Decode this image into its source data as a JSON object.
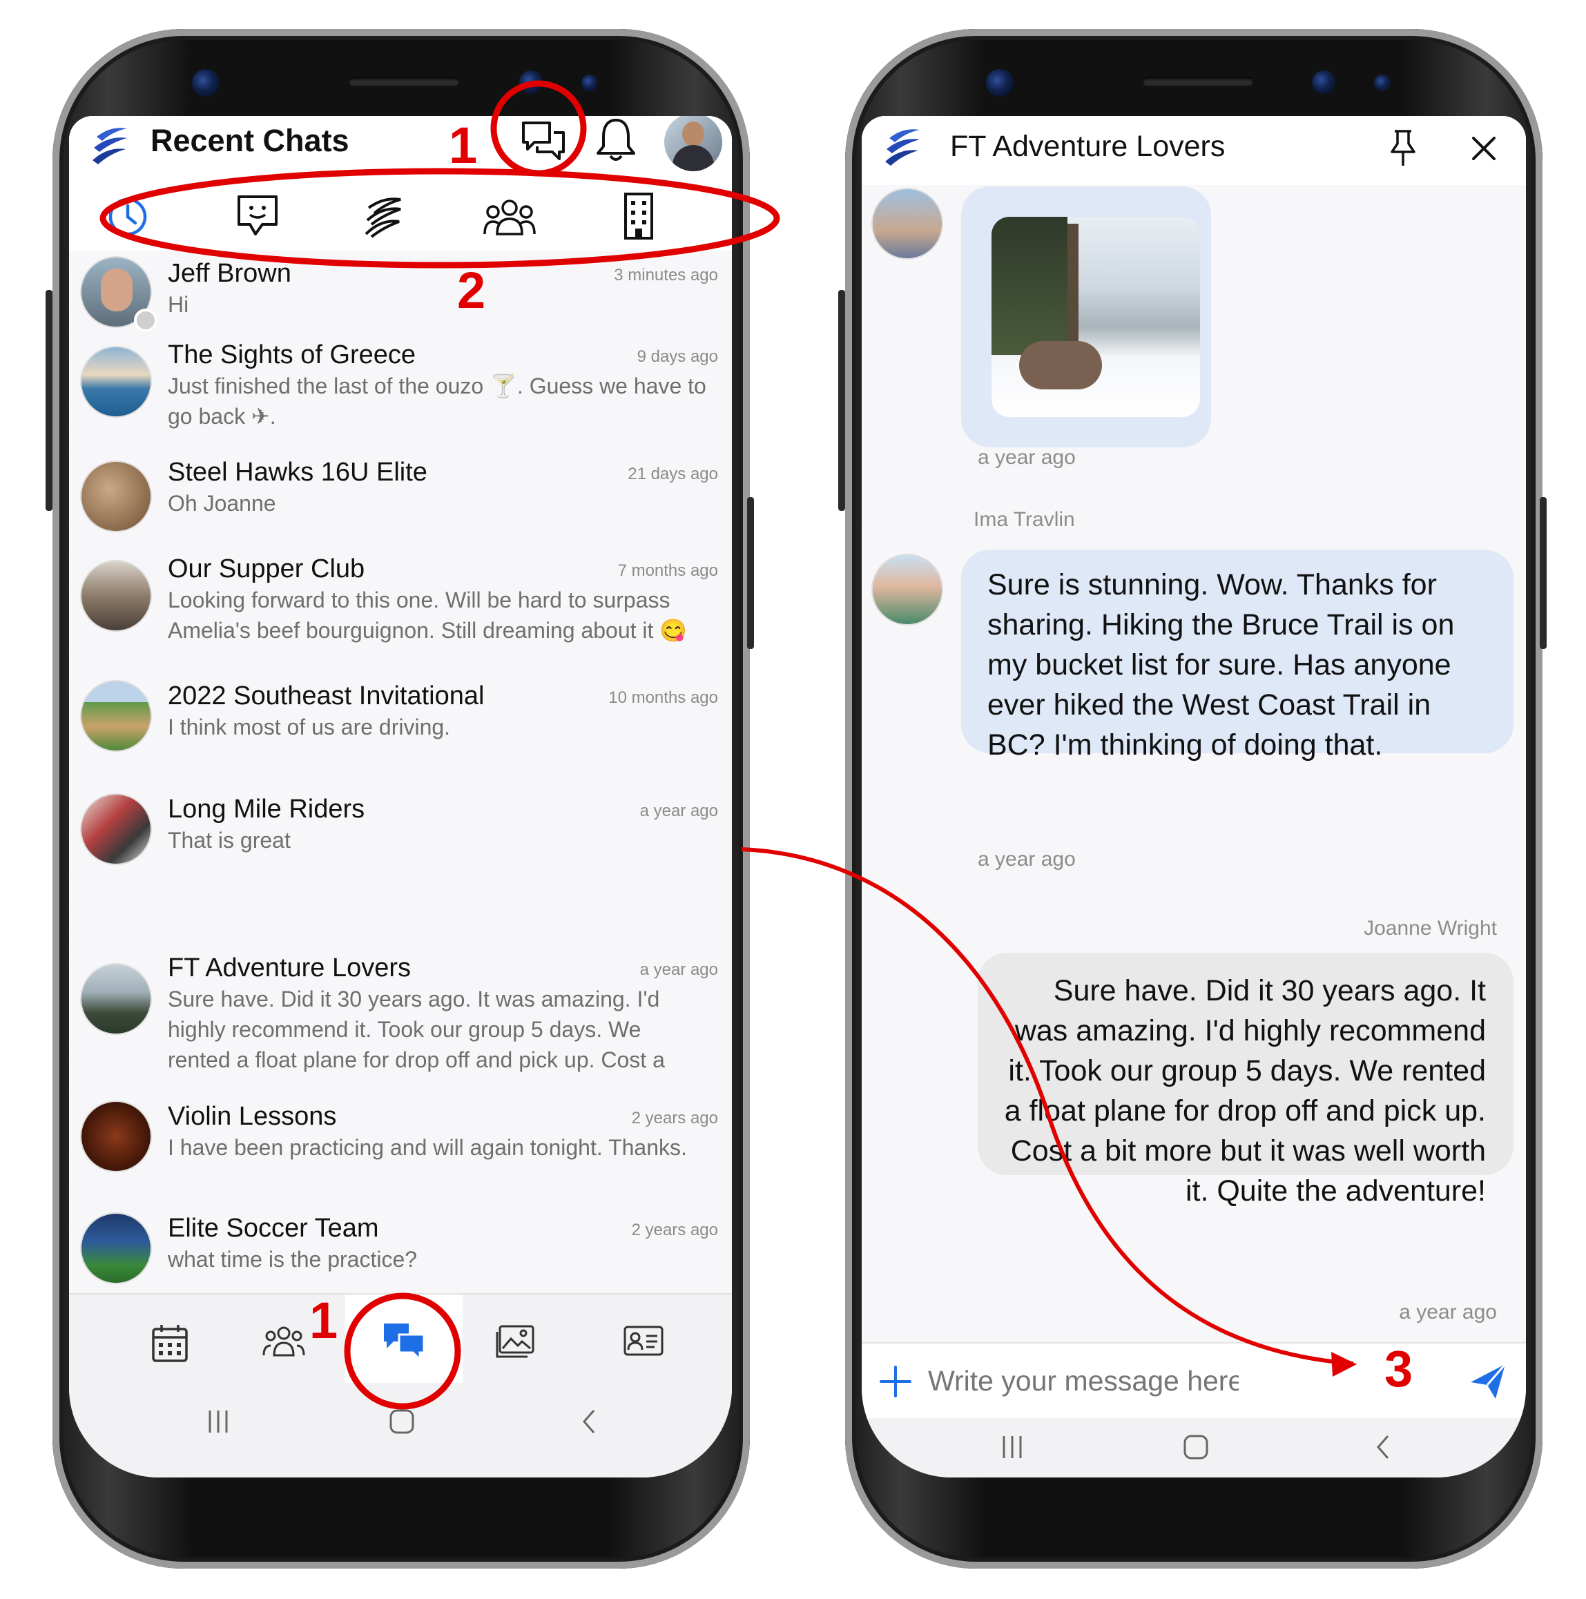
{
  "left_screen": {
    "header_title": "Recent Chats",
    "chats": [
      {
        "name": "Jeff Brown",
        "time": "3 minutes ago",
        "message": "Hi"
      },
      {
        "name": "The Sights of Greece",
        "time": "9 days ago",
        "message": "Just finished the last of the ouzo 🍸. Guess we have to go back ✈."
      },
      {
        "name": "Steel Hawks 16U Elite",
        "time": "21 days ago",
        "message": "Oh Joanne"
      },
      {
        "name": "Our Supper Club",
        "time": "7 months ago",
        "message": "Looking forward to this one. Will be hard to surpass Amelia's beef bourguignon. Still dreaming about it 😋"
      },
      {
        "name": "2022 Southeast Invitational",
        "time": "10 months ago",
        "message": "I think most of us are driving."
      },
      {
        "name": "Long Mile Riders",
        "time": "a year ago",
        "message": "That is great"
      },
      {
        "name": "FT Adventure Lovers",
        "time": "a year ago",
        "message": "Sure have. Did it 30 years ago. It was amazing. I'd highly recommend it. Took our group 5 days. We rented a float plane for drop off and pick up. Cost a"
      },
      {
        "name": "Violin Lessons",
        "time": "2 years ago",
        "message": "I have been practicing and will again tonight. Thanks."
      },
      {
        "name": "Elite Soccer Team",
        "time": "2 years ago",
        "message": "what time is the practice?"
      }
    ],
    "top_icons": [
      "chats-icon",
      "bell-icon",
      "profile-avatar"
    ],
    "filter_tabs": [
      "clock-icon",
      "message-smile-icon",
      "logo-icon",
      "group-icon",
      "building-icon"
    ],
    "bottom_nav": [
      "calendar-icon",
      "people-icon",
      "chat-bubbles-icon",
      "gallery-icon",
      "contact-card-icon"
    ]
  },
  "right_screen": {
    "header_title": "FT Adventure Lovers",
    "messages": [
      {
        "type": "image",
        "time": "a year ago"
      },
      {
        "sender": "Ima Travlin",
        "text": "Sure is stunning. Wow. Thanks for sharing. Hiking the Bruce Trail is on my bucket list for sure. Has anyone ever hiked the West Coast Trail in BC? I'm thinking of doing that.",
        "time": "a year ago"
      },
      {
        "sender": "Joanne Wright",
        "text": "Sure have. Did it 30 years ago. It was amazing. I'd highly recommend it. Took our group 5 days. We rented a float plane for drop off and pick up. Cost a bit more but it was well worth it. Quite the adventure!",
        "time": "a year ago"
      }
    ],
    "input_placeholder": "Write your message here..."
  },
  "annotations": {
    "label_1a": "1",
    "label_1b": "1",
    "label_2": "2",
    "label_3": "3"
  },
  "colors": {
    "accent_blue": "#1e6fe6",
    "bubble_blue": "#dfe8f7",
    "bubble_grey": "#e9e9ea",
    "annotation_red": "#e00000"
  }
}
